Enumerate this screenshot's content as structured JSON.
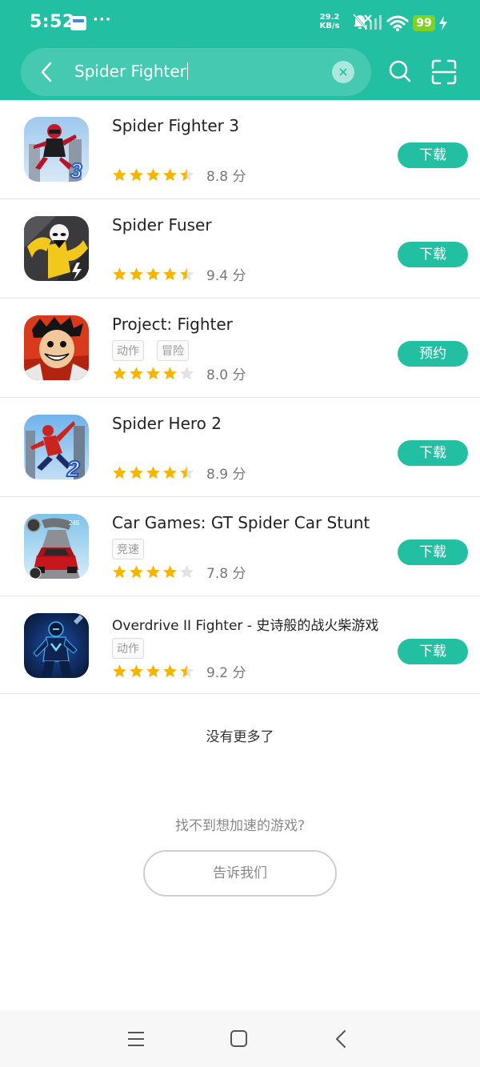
{
  "status": {
    "time": "5:52",
    "speed_value": "29.2",
    "speed_unit": "KB/s",
    "battery": "99",
    "dots": "···"
  },
  "search": {
    "query": "Spider Fighter"
  },
  "apps": [
    {
      "name": "Spider Fighter 3",
      "tags": [],
      "rating": 4.5,
      "score": "8.8 分",
      "button": "下载"
    },
    {
      "name": "Spider Fuser",
      "tags": [],
      "rating": 4.5,
      "score": "9.4 分",
      "button": "下载"
    },
    {
      "name": "Project: Fighter",
      "tags": [
        "动作",
        "冒险"
      ],
      "rating": 4,
      "score": "8.0 分",
      "button": "预约"
    },
    {
      "name": "Spider Hero 2",
      "tags": [],
      "rating": 4.5,
      "score": "8.9 分",
      "button": "下载"
    },
    {
      "name": "Car Games: GT Spider Car Stunt",
      "tags": [
        "竞速"
      ],
      "rating": 4,
      "score": "7.8 分",
      "button": "下载"
    },
    {
      "name": "Overdrive II Fighter - 史诗般的战火柴游戏",
      "tags": [
        "动作"
      ],
      "rating": 4.5,
      "score": "9.2 分",
      "button": "下载"
    }
  ],
  "footer": {
    "no_more": "没有更多了",
    "not_found": "找不到想加速的游戏?",
    "tell_us": "告诉我们"
  },
  "colors": {
    "brand": "#22bfa3",
    "star": "#f7b500"
  }
}
